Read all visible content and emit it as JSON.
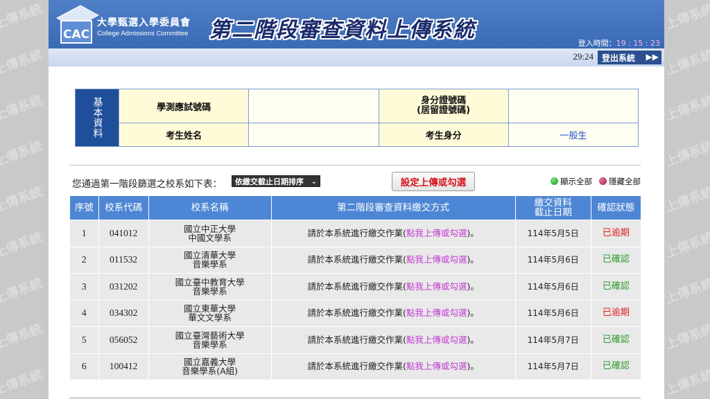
{
  "header": {
    "org_cn": "大學甄選入學委員會",
    "org_en": "College Admissions Committee",
    "system_title": "第二階段審查資料上傳系統",
    "login_label": "登入時間：",
    "login_time": "19 : 15 : 23",
    "countdown": "29:24",
    "logout_label": "登出系統"
  },
  "basic_info": {
    "side_label": "基本資料",
    "exam_id_label": "學測應試號碼",
    "exam_id_value": "",
    "id_label": "身分證號碼\n(居留證號碼)",
    "id_value": "",
    "name_label": "考生姓名",
    "name_value": "",
    "status_label": "考生身分",
    "status_value": "一般生"
  },
  "controls": {
    "intro": "您通過第一階段篩選之校系如下表：",
    "sort_selected": "依繳交截止日期排序",
    "set_button": "設定上傳或勾選",
    "show_all": "顯示全部",
    "hide_all": "隱藏全部"
  },
  "table": {
    "headers": [
      "序號",
      "校系代碼",
      "校系名稱",
      "第二階段審查資料繳交方式",
      "繳交資料\n截止日期",
      "確認狀態"
    ],
    "method_prefix": "請於本系統進行繳交作業(",
    "method_link": "點我上傳或勾選",
    "method_suffix": ")。",
    "rows": [
      {
        "no": "1",
        "code": "041012",
        "school": "國立中正大學",
        "dept": "中國文學系",
        "deadline": "114年5月5日",
        "status": "已逾期",
        "status_type": "over"
      },
      {
        "no": "2",
        "code": "011532",
        "school": "國立清華大學",
        "dept": "音樂學系",
        "deadline": "114年5月6日",
        "status": "已確認",
        "status_type": "ok"
      },
      {
        "no": "3",
        "code": "031202",
        "school": "國立臺中教育大學",
        "dept": "音樂學系",
        "deadline": "114年5月6日",
        "status": "已確認",
        "status_type": "ok"
      },
      {
        "no": "4",
        "code": "034302",
        "school": "國立東華大學",
        "dept": "華文文學系",
        "deadline": "114年5月6日",
        "status": "已逾期",
        "status_type": "over"
      },
      {
        "no": "5",
        "code": "056052",
        "school": "國立臺灣藝術大學",
        "dept": "音樂學系",
        "deadline": "114年5月7日",
        "status": "已確認",
        "status_type": "ok"
      },
      {
        "no": "6",
        "code": "100412",
        "school": "國立嘉義大學",
        "dept": "音樂學系(A組)",
        "deadline": "114年5月7日",
        "status": "已確認",
        "status_type": "ok"
      }
    ]
  },
  "colors": {
    "header_blue": "#3a6ab5",
    "table_header": "#4d86d4",
    "overdue": "#e02020",
    "confirmed": "#2e9a2e",
    "link": "#c03bd0"
  }
}
